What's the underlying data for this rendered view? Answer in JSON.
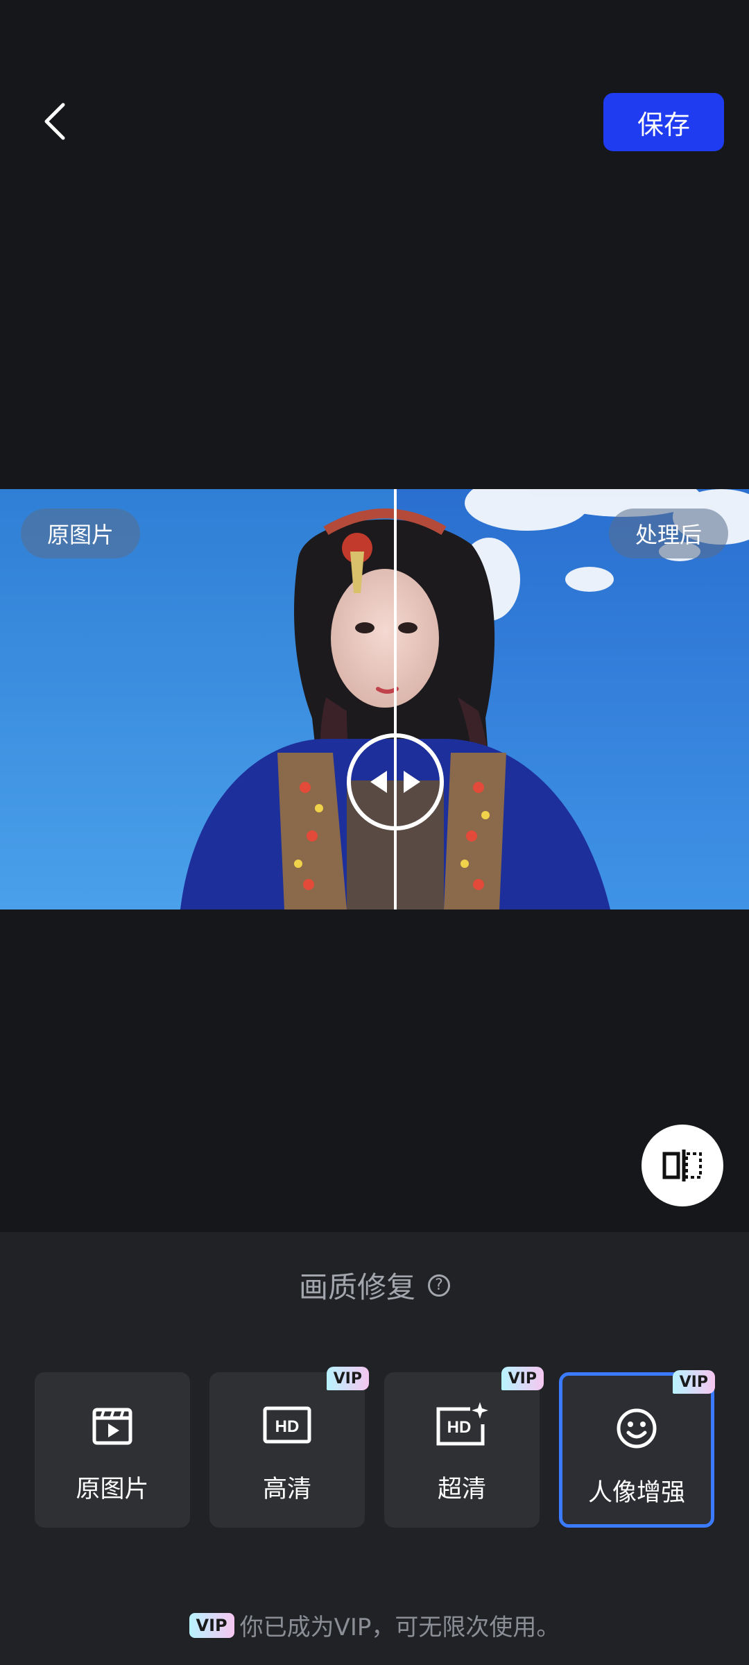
{
  "header": {
    "back_icon": "chevron-left-icon",
    "save_label": "保存",
    "save_color": "#1f3cf0"
  },
  "compare": {
    "left_label": "原图片",
    "right_label": "处理后",
    "handle_icon": "split-arrows-icon",
    "toggle_icon": "compare-toggle-icon"
  },
  "panel": {
    "title": "画质修复",
    "help_icon": "question-circle-icon",
    "options": [
      {
        "label": "原图片",
        "icon": "video-clapper-icon",
        "vip": false,
        "selected": false
      },
      {
        "label": "高清",
        "icon": "hd-icon",
        "vip": true,
        "vip_label": "VIP",
        "selected": false
      },
      {
        "label": "超清",
        "icon": "hd-sparkle-icon",
        "vip": true,
        "vip_label": "VIP",
        "selected": false
      },
      {
        "label": "人像增强",
        "icon": "smile-face-icon",
        "vip": true,
        "vip_label": "VIP",
        "selected": true
      }
    ],
    "footer_vip": "VIP",
    "footer_text": "你已成为VIP，可无限次使用。",
    "accent_color": "#3b7bff"
  }
}
